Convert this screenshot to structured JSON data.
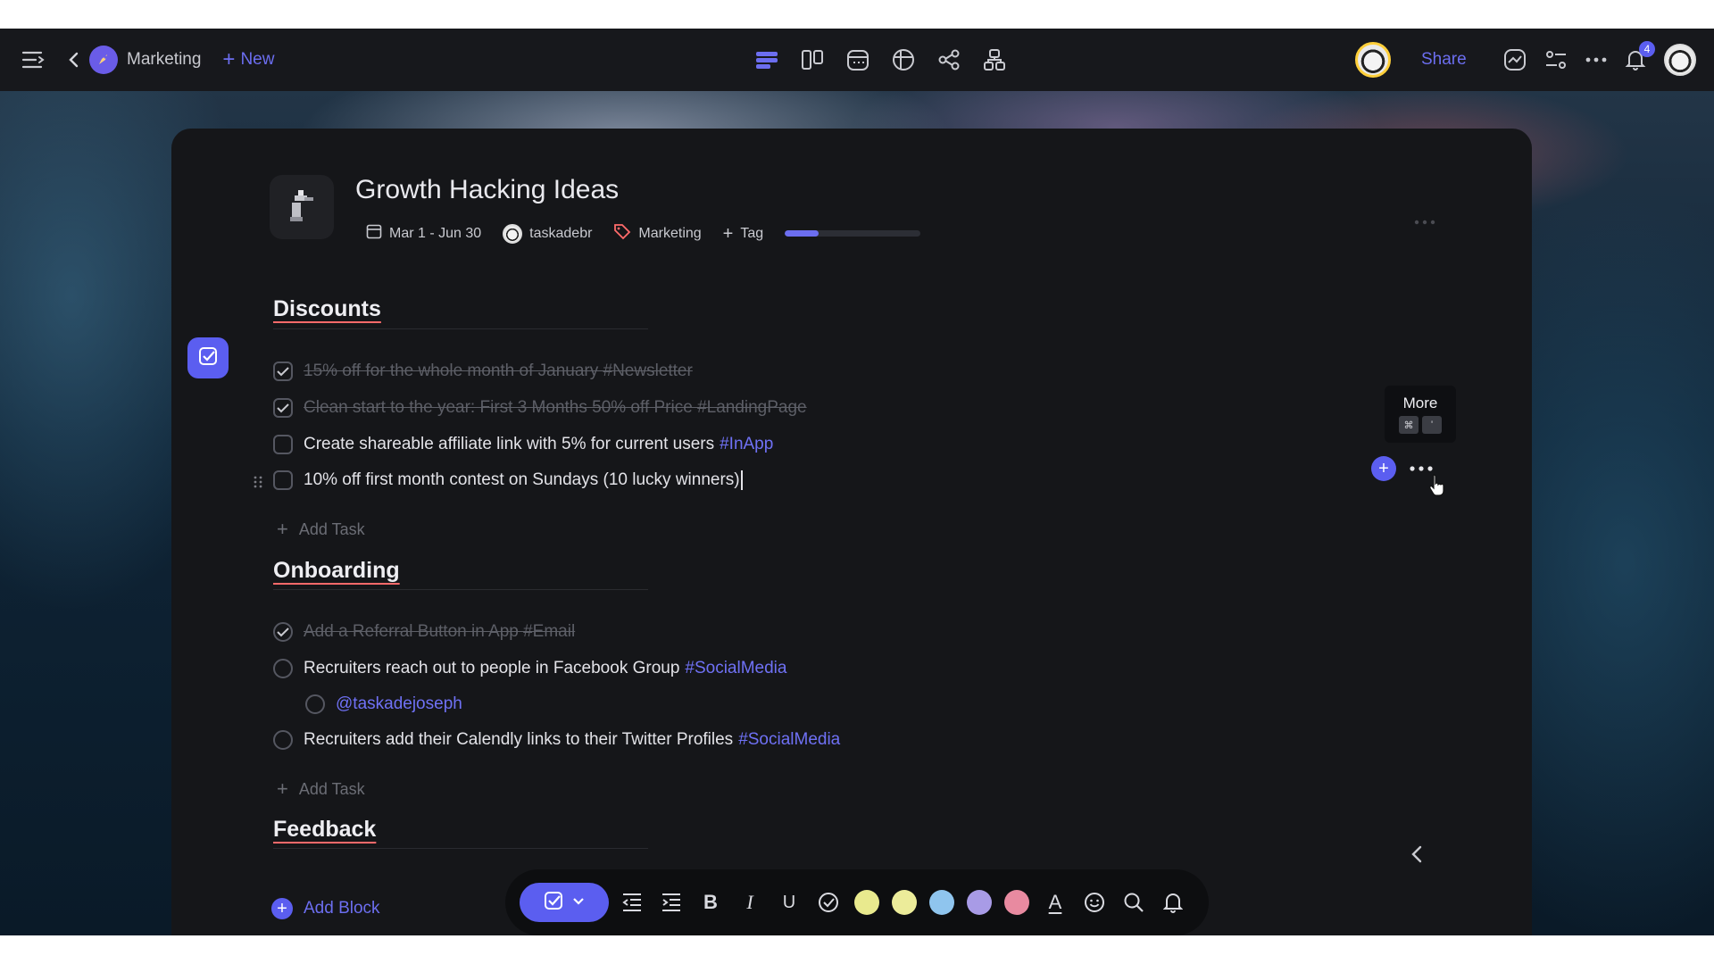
{
  "topbar": {
    "menu_icon": "menu-collapse-icon",
    "back_icon": "chevron-left-icon",
    "workspace_icon": "rocket-icon",
    "workspace_name": "Marketing",
    "new_label": "New",
    "views": [
      "list-view-icon",
      "board-view-icon",
      "calendar-view-icon",
      "table-view-icon",
      "mindmap-view-icon",
      "org-chart-view-icon"
    ],
    "share_label": "Share",
    "notification_count": "4"
  },
  "project": {
    "icon": "faucet-icon",
    "title": "Growth Hacking Ideas",
    "date_range": "Mar 1 - Jun 30",
    "owner": "taskadebr",
    "label": "Marketing",
    "add_tag": "Tag",
    "progress_fraction": 0.25
  },
  "sections": [
    {
      "title": "Discounts",
      "tasks": [
        {
          "text": "15% off for the whole month of January #Newsletter",
          "done": true
        },
        {
          "text": "Clean start to the year: First 3 Months 50% off Price #LandingPage",
          "done": true
        },
        {
          "text": "Create shareable affiliate link with 5%  for current users",
          "tag": "#InApp",
          "done": false
        },
        {
          "text": "10% off first month contest on Sundays (10 lucky winners)",
          "done": false
        }
      ],
      "add_task": "Add Task"
    },
    {
      "title": "Onboarding",
      "tasks": [
        {
          "text": "Add a Referral Button in App #Email",
          "done": true
        },
        {
          "text": "Recruiters reach out to people in Facebook Group",
          "tag": "#SocialMedia",
          "done": false
        },
        {
          "mention": "@taskadejoseph",
          "done": false
        },
        {
          "text": "Recruiters add their Calendly links to their Twitter Profiles",
          "tag": "#SocialMedia",
          "done": false
        }
      ],
      "add_task": "Add Task"
    },
    {
      "title": "Feedback"
    }
  ],
  "tooltip": {
    "label": "More",
    "keys": [
      "⌘",
      "'"
    ]
  },
  "add_block": "Add Block",
  "toolbar": {
    "swatches": [
      "#e9ea8e",
      "#ecec9a",
      "#8fc5ee",
      "#a89be6",
      "#e88aa0"
    ]
  }
}
